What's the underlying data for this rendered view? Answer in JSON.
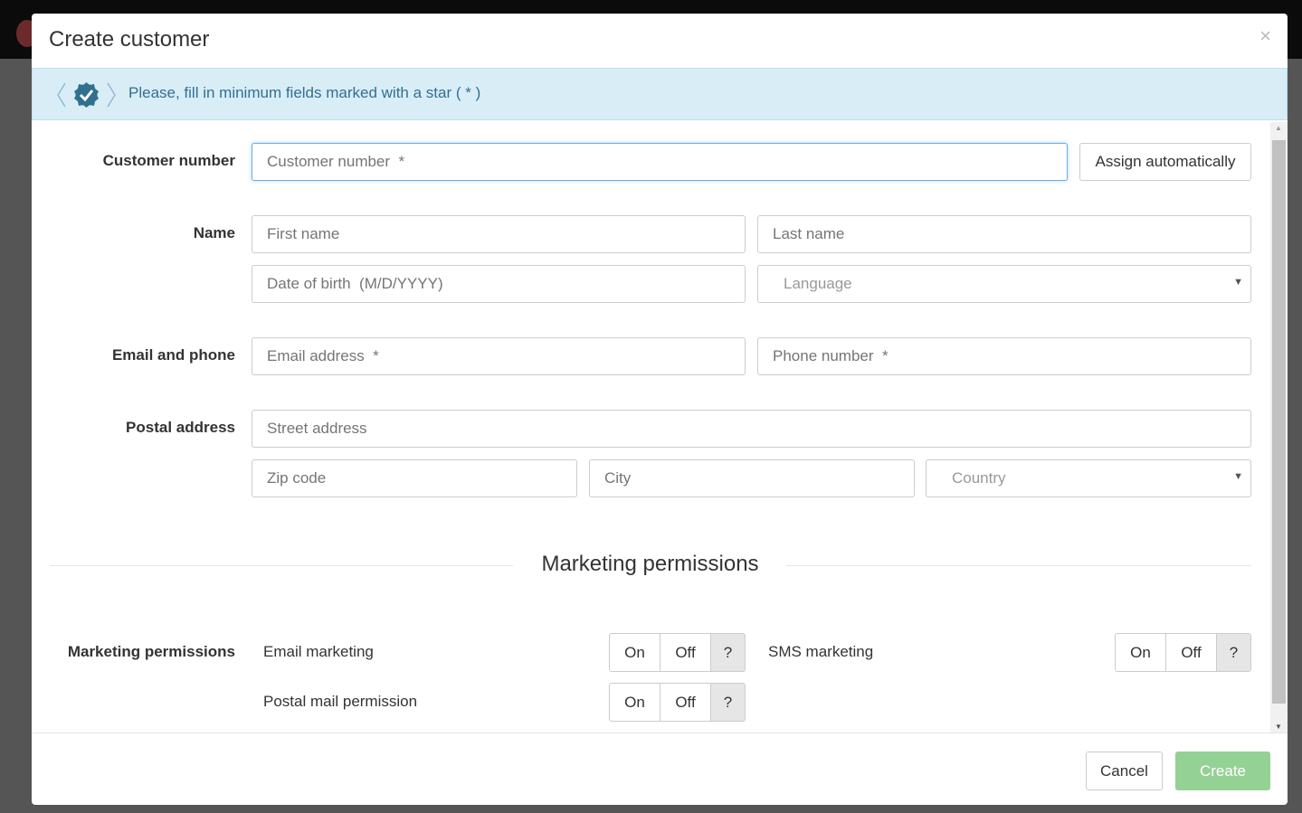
{
  "dialog": {
    "title": "Create customer",
    "close_icon": "close-icon"
  },
  "banner": {
    "text": "Please, fill in minimum fields marked with a star ( * )",
    "icon": "verified-badge-icon",
    "color": "#31708f"
  },
  "form": {
    "customer_number": {
      "label": "Customer number",
      "placeholder": "Customer number  *",
      "assign_button": "Assign automatically"
    },
    "name": {
      "label": "Name",
      "first_placeholder": "First name",
      "last_placeholder": "Last name",
      "dob_placeholder": "Date of birth  (M/D/YYYY)",
      "language_placeholder": "Language"
    },
    "contact": {
      "label": "Email and phone",
      "email_placeholder": "Email address  *",
      "phone_placeholder": "Phone number  *"
    },
    "address": {
      "label": "Postal address",
      "street_placeholder": "Street address",
      "zip_placeholder": "Zip code",
      "city_placeholder": "City",
      "country_placeholder": "Country"
    }
  },
  "marketing": {
    "section_title": "Marketing permissions",
    "label": "Marketing permissions",
    "items": [
      {
        "label": "Email marketing",
        "on": "On",
        "off": "Off",
        "unset": "?"
      },
      {
        "label": "SMS marketing",
        "on": "On",
        "off": "Off",
        "unset": "?"
      },
      {
        "label": "Postal mail permission",
        "on": "On",
        "off": "Off",
        "unset": "?"
      }
    ]
  },
  "footer": {
    "cancel": "Cancel",
    "create": "Create",
    "create_color": "#94d195"
  }
}
